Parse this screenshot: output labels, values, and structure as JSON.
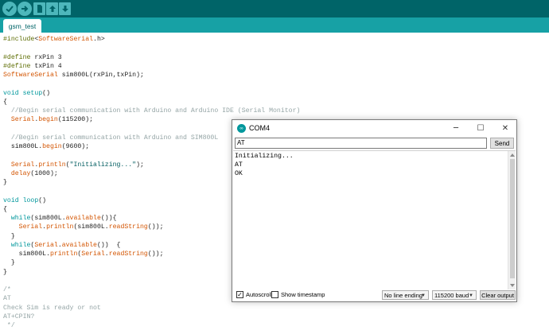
{
  "toolbar": {
    "buttons": [
      {
        "name": "verify",
        "icon": "checkmark-icon"
      },
      {
        "name": "upload",
        "icon": "arrow-right-icon"
      },
      {
        "name": "new",
        "icon": "new-file-icon"
      },
      {
        "name": "open",
        "icon": "arrow-up-icon"
      },
      {
        "name": "save",
        "icon": "arrow-down-icon"
      }
    ],
    "colors": {
      "bar": "#006468",
      "button": "#4db7bb",
      "tabbar": "#17a1a5"
    }
  },
  "tab": {
    "label": "gsm_test"
  },
  "editor": {
    "lines": [
      [
        [
          "pre",
          "#include"
        ],
        [
          "",
          "<"
        ],
        [
          "typ",
          "SoftwareSerial"
        ],
        [
          "",
          ".h>"
        ]
      ],
      [],
      [
        [
          "pre",
          "#define"
        ],
        [
          "",
          " rxPin 3"
        ]
      ],
      [
        [
          "pre",
          "#define"
        ],
        [
          "",
          " txPin 4"
        ]
      ],
      [
        [
          "typ",
          "SoftwareSerial"
        ],
        [
          "",
          " sim800L(rxPin,txPin);"
        ]
      ],
      [],
      [
        [
          "kw",
          "void"
        ],
        [
          "",
          " "
        ],
        [
          "kw",
          "setup"
        ],
        [
          "",
          "()"
        ]
      ],
      [
        [
          "",
          "{"
        ]
      ],
      [
        [
          "cm",
          "  //Begin serial communication with Arduino and Arduino IDE (Serial Monitor)"
        ]
      ],
      [
        [
          "",
          "  "
        ],
        [
          "typ",
          "Serial"
        ],
        [
          "",
          "."
        ],
        [
          "fn",
          "begin"
        ],
        [
          "",
          "(115200);"
        ]
      ],
      [],
      [
        [
          "cm",
          "  //Begin serial communication with Arduino and SIM800L"
        ]
      ],
      [
        [
          "",
          "  sim800L."
        ],
        [
          "fn",
          "begin"
        ],
        [
          "",
          "(9600);"
        ]
      ],
      [],
      [
        [
          "",
          "  "
        ],
        [
          "typ",
          "Serial"
        ],
        [
          "",
          "."
        ],
        [
          "fn",
          "println"
        ],
        [
          "",
          "("
        ],
        [
          "str",
          "\"Initializing...\""
        ],
        [
          "",
          ");"
        ]
      ],
      [
        [
          "",
          "  "
        ],
        [
          "fn",
          "delay"
        ],
        [
          "",
          "(1000);"
        ]
      ],
      [
        [
          "",
          "}"
        ]
      ],
      [],
      [
        [
          "kw",
          "void"
        ],
        [
          "",
          " "
        ],
        [
          "kw",
          "loop"
        ],
        [
          "",
          "()"
        ]
      ],
      [
        [
          "",
          "{"
        ]
      ],
      [
        [
          "",
          "  "
        ],
        [
          "kw",
          "while"
        ],
        [
          "",
          "(sim800L."
        ],
        [
          "fn",
          "available"
        ],
        [
          "",
          "()){"
        ]
      ],
      [
        [
          "",
          "    "
        ],
        [
          "typ",
          "Serial"
        ],
        [
          "",
          "."
        ],
        [
          "fn",
          "println"
        ],
        [
          "",
          "(sim800L."
        ],
        [
          "fn",
          "readString"
        ],
        [
          "",
          "());"
        ]
      ],
      [
        [
          "",
          "  }"
        ]
      ],
      [
        [
          "",
          "  "
        ],
        [
          "kw",
          "while"
        ],
        [
          "",
          "("
        ],
        [
          "typ",
          "Serial"
        ],
        [
          "",
          "."
        ],
        [
          "fn",
          "available"
        ],
        [
          "",
          "())  {"
        ]
      ],
      [
        [
          "",
          "    sim800L."
        ],
        [
          "fn",
          "println"
        ],
        [
          "",
          "("
        ],
        [
          "typ",
          "Serial"
        ],
        [
          "",
          "."
        ],
        [
          "fn",
          "readString"
        ],
        [
          "",
          "());"
        ]
      ],
      [
        [
          "",
          "  }"
        ]
      ],
      [
        [
          "",
          "}"
        ]
      ],
      [],
      [
        [
          "cm",
          "/*"
        ]
      ],
      [
        [
          "cm",
          "AT"
        ]
      ],
      [
        [
          "cm",
          "Check Sim is ready or not"
        ]
      ],
      [
        [
          "cm",
          "AT+CPIN?"
        ]
      ],
      [
        [
          "cm",
          " */"
        ]
      ]
    ]
  },
  "serial_monitor": {
    "title": "COM4",
    "logo_icon": "arduino-logo-icon",
    "input_value": "AT",
    "send_label": "Send",
    "output": "Initializing...\nAT\nOK",
    "autoscroll_label": "Autoscroll",
    "autoscroll_checked": true,
    "timestamp_label": "Show timestamp",
    "timestamp_checked": false,
    "line_ending": "No line ending",
    "baud": "115200 baud",
    "clear_label": "Clear output",
    "controls": {
      "minimize": "─",
      "maximize": "☐",
      "close": "✕"
    }
  }
}
